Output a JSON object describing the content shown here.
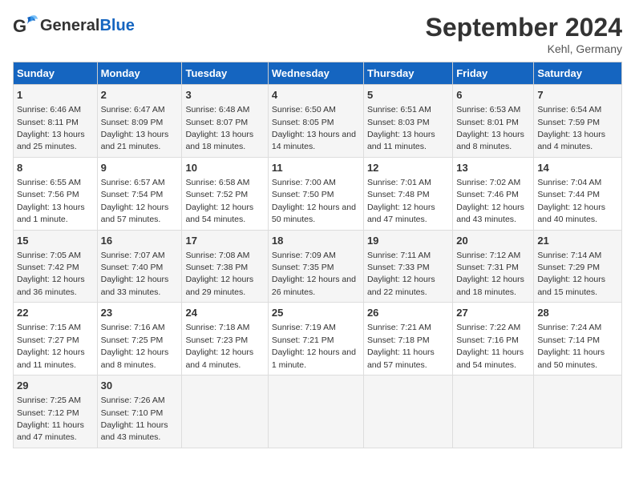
{
  "header": {
    "logo_general": "General",
    "logo_blue": "Blue",
    "main_title": "September 2024",
    "subtitle": "Kehl, Germany"
  },
  "days_of_week": [
    "Sunday",
    "Monday",
    "Tuesday",
    "Wednesday",
    "Thursday",
    "Friday",
    "Saturday"
  ],
  "weeks": [
    [
      {
        "day": "1",
        "sunrise": "Sunrise: 6:46 AM",
        "sunset": "Sunset: 8:11 PM",
        "daylight": "Daylight: 13 hours and 25 minutes."
      },
      {
        "day": "2",
        "sunrise": "Sunrise: 6:47 AM",
        "sunset": "Sunset: 8:09 PM",
        "daylight": "Daylight: 13 hours and 21 minutes."
      },
      {
        "day": "3",
        "sunrise": "Sunrise: 6:48 AM",
        "sunset": "Sunset: 8:07 PM",
        "daylight": "Daylight: 13 hours and 18 minutes."
      },
      {
        "day": "4",
        "sunrise": "Sunrise: 6:50 AM",
        "sunset": "Sunset: 8:05 PM",
        "daylight": "Daylight: 13 hours and 14 minutes."
      },
      {
        "day": "5",
        "sunrise": "Sunrise: 6:51 AM",
        "sunset": "Sunset: 8:03 PM",
        "daylight": "Daylight: 13 hours and 11 minutes."
      },
      {
        "day": "6",
        "sunrise": "Sunrise: 6:53 AM",
        "sunset": "Sunset: 8:01 PM",
        "daylight": "Daylight: 13 hours and 8 minutes."
      },
      {
        "day": "7",
        "sunrise": "Sunrise: 6:54 AM",
        "sunset": "Sunset: 7:59 PM",
        "daylight": "Daylight: 13 hours and 4 minutes."
      }
    ],
    [
      {
        "day": "8",
        "sunrise": "Sunrise: 6:55 AM",
        "sunset": "Sunset: 7:56 PM",
        "daylight": "Daylight: 13 hours and 1 minute."
      },
      {
        "day": "9",
        "sunrise": "Sunrise: 6:57 AM",
        "sunset": "Sunset: 7:54 PM",
        "daylight": "Daylight: 12 hours and 57 minutes."
      },
      {
        "day": "10",
        "sunrise": "Sunrise: 6:58 AM",
        "sunset": "Sunset: 7:52 PM",
        "daylight": "Daylight: 12 hours and 54 minutes."
      },
      {
        "day": "11",
        "sunrise": "Sunrise: 7:00 AM",
        "sunset": "Sunset: 7:50 PM",
        "daylight": "Daylight: 12 hours and 50 minutes."
      },
      {
        "day": "12",
        "sunrise": "Sunrise: 7:01 AM",
        "sunset": "Sunset: 7:48 PM",
        "daylight": "Daylight: 12 hours and 47 minutes."
      },
      {
        "day": "13",
        "sunrise": "Sunrise: 7:02 AM",
        "sunset": "Sunset: 7:46 PM",
        "daylight": "Daylight: 12 hours and 43 minutes."
      },
      {
        "day": "14",
        "sunrise": "Sunrise: 7:04 AM",
        "sunset": "Sunset: 7:44 PM",
        "daylight": "Daylight: 12 hours and 40 minutes."
      }
    ],
    [
      {
        "day": "15",
        "sunrise": "Sunrise: 7:05 AM",
        "sunset": "Sunset: 7:42 PM",
        "daylight": "Daylight: 12 hours and 36 minutes."
      },
      {
        "day": "16",
        "sunrise": "Sunrise: 7:07 AM",
        "sunset": "Sunset: 7:40 PM",
        "daylight": "Daylight: 12 hours and 33 minutes."
      },
      {
        "day": "17",
        "sunrise": "Sunrise: 7:08 AM",
        "sunset": "Sunset: 7:38 PM",
        "daylight": "Daylight: 12 hours and 29 minutes."
      },
      {
        "day": "18",
        "sunrise": "Sunrise: 7:09 AM",
        "sunset": "Sunset: 7:35 PM",
        "daylight": "Daylight: 12 hours and 26 minutes."
      },
      {
        "day": "19",
        "sunrise": "Sunrise: 7:11 AM",
        "sunset": "Sunset: 7:33 PM",
        "daylight": "Daylight: 12 hours and 22 minutes."
      },
      {
        "day": "20",
        "sunrise": "Sunrise: 7:12 AM",
        "sunset": "Sunset: 7:31 PM",
        "daylight": "Daylight: 12 hours and 18 minutes."
      },
      {
        "day": "21",
        "sunrise": "Sunrise: 7:14 AM",
        "sunset": "Sunset: 7:29 PM",
        "daylight": "Daylight: 12 hours and 15 minutes."
      }
    ],
    [
      {
        "day": "22",
        "sunrise": "Sunrise: 7:15 AM",
        "sunset": "Sunset: 7:27 PM",
        "daylight": "Daylight: 12 hours and 11 minutes."
      },
      {
        "day": "23",
        "sunrise": "Sunrise: 7:16 AM",
        "sunset": "Sunset: 7:25 PM",
        "daylight": "Daylight: 12 hours and 8 minutes."
      },
      {
        "day": "24",
        "sunrise": "Sunrise: 7:18 AM",
        "sunset": "Sunset: 7:23 PM",
        "daylight": "Daylight: 12 hours and 4 minutes."
      },
      {
        "day": "25",
        "sunrise": "Sunrise: 7:19 AM",
        "sunset": "Sunset: 7:21 PM",
        "daylight": "Daylight: 12 hours and 1 minute."
      },
      {
        "day": "26",
        "sunrise": "Sunrise: 7:21 AM",
        "sunset": "Sunset: 7:18 PM",
        "daylight": "Daylight: 11 hours and 57 minutes."
      },
      {
        "day": "27",
        "sunrise": "Sunrise: 7:22 AM",
        "sunset": "Sunset: 7:16 PM",
        "daylight": "Daylight: 11 hours and 54 minutes."
      },
      {
        "day": "28",
        "sunrise": "Sunrise: 7:24 AM",
        "sunset": "Sunset: 7:14 PM",
        "daylight": "Daylight: 11 hours and 50 minutes."
      }
    ],
    [
      {
        "day": "29",
        "sunrise": "Sunrise: 7:25 AM",
        "sunset": "Sunset: 7:12 PM",
        "daylight": "Daylight: 11 hours and 47 minutes."
      },
      {
        "day": "30",
        "sunrise": "Sunrise: 7:26 AM",
        "sunset": "Sunset: 7:10 PM",
        "daylight": "Daylight: 11 hours and 43 minutes."
      },
      null,
      null,
      null,
      null,
      null
    ]
  ]
}
